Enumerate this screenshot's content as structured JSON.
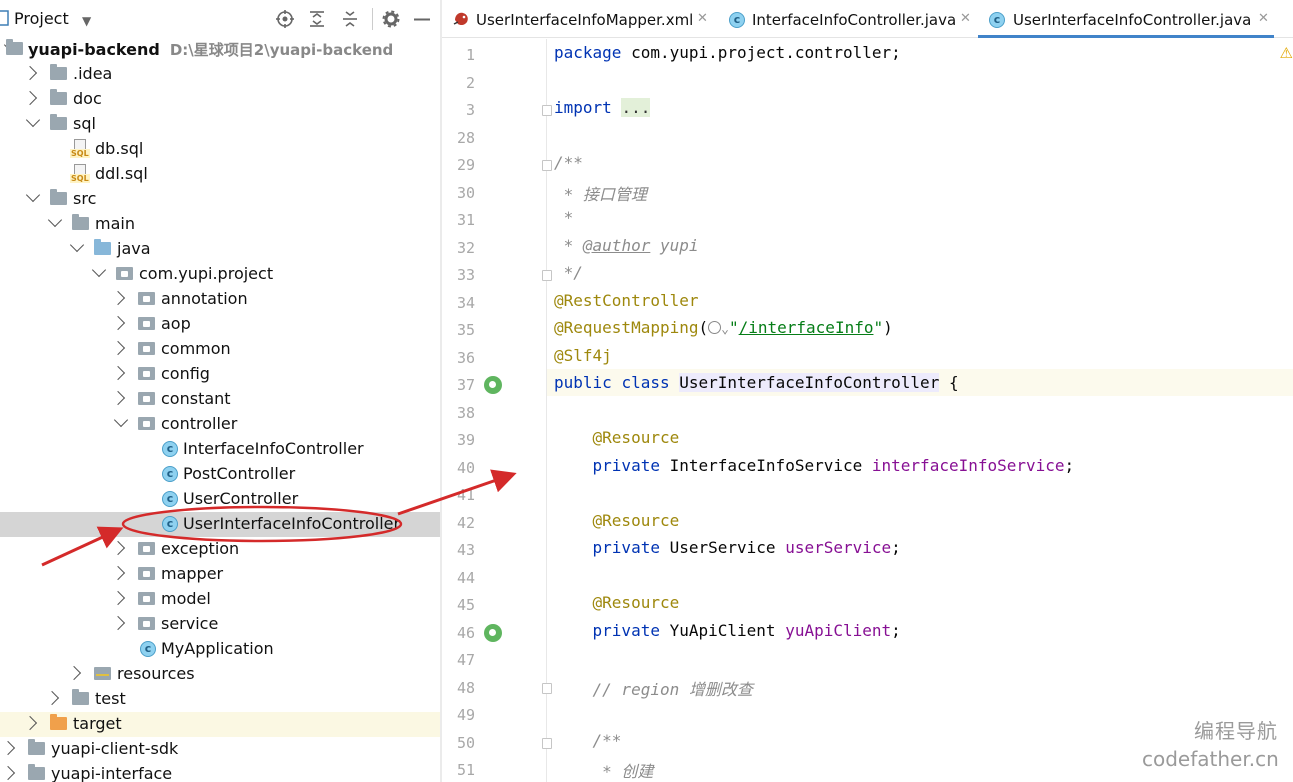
{
  "project_panel": {
    "title": "Project",
    "icons": [
      "locate-icon",
      "expand-all-icon",
      "collapse-all-icon",
      "gear-icon",
      "hide-icon"
    ],
    "tree": [
      {
        "label": "yuapi-backend",
        "path": "D:\\星球项目2\\yuapi-backend",
        "icon": "module-folder",
        "arrow": "expanded",
        "depth": 0
      },
      {
        "label": ".idea",
        "icon": "folder",
        "arrow": "collapsed",
        "depth": 1
      },
      {
        "label": "doc",
        "icon": "folder",
        "arrow": "collapsed",
        "depth": 1
      },
      {
        "label": "sql",
        "icon": "folder",
        "arrow": "expanded",
        "depth": 1
      },
      {
        "label": "db.sql",
        "icon": "sql-file",
        "arrow": "none",
        "depth": 2
      },
      {
        "label": "ddl.sql",
        "icon": "sql-file",
        "arrow": "none",
        "depth": 2
      },
      {
        "label": "src",
        "icon": "folder",
        "arrow": "expanded",
        "depth": 1
      },
      {
        "label": "main",
        "icon": "folder",
        "arrow": "expanded",
        "depth": 2
      },
      {
        "label": "java",
        "icon": "folder-blue",
        "arrow": "expanded",
        "depth": 3
      },
      {
        "label": "com.yupi.project",
        "icon": "package",
        "arrow": "expanded",
        "depth": 4
      },
      {
        "label": "annotation",
        "icon": "package",
        "arrow": "collapsed",
        "depth": 5
      },
      {
        "label": "aop",
        "icon": "package",
        "arrow": "collapsed",
        "depth": 5
      },
      {
        "label": "common",
        "icon": "package",
        "arrow": "collapsed",
        "depth": 5
      },
      {
        "label": "config",
        "icon": "package",
        "arrow": "collapsed",
        "depth": 5
      },
      {
        "label": "constant",
        "icon": "package",
        "arrow": "collapsed",
        "depth": 5
      },
      {
        "label": "controller",
        "icon": "package",
        "arrow": "expanded",
        "depth": 5
      },
      {
        "label": "InterfaceInfoController",
        "icon": "class",
        "arrow": "none",
        "depth": 6
      },
      {
        "label": "PostController",
        "icon": "class",
        "arrow": "none",
        "depth": 6
      },
      {
        "label": "UserController",
        "icon": "class",
        "arrow": "none",
        "depth": 6
      },
      {
        "label": "UserInterfaceInfoController",
        "icon": "class",
        "arrow": "none",
        "depth": 6,
        "selected": true
      },
      {
        "label": "exception",
        "icon": "package",
        "arrow": "collapsed",
        "depth": 5
      },
      {
        "label": "mapper",
        "icon": "package",
        "arrow": "collapsed",
        "depth": 5
      },
      {
        "label": "model",
        "icon": "package",
        "arrow": "collapsed",
        "depth": 5
      },
      {
        "label": "service",
        "icon": "package",
        "arrow": "collapsed",
        "depth": 5
      },
      {
        "label": "MyApplication",
        "icon": "class",
        "arrow": "none",
        "depth": 5
      },
      {
        "label": "resources",
        "icon": "resources",
        "arrow": "collapsed",
        "depth": 3
      },
      {
        "label": "test",
        "icon": "folder",
        "arrow": "collapsed",
        "depth": 2
      },
      {
        "label": "target",
        "icon": "folder-orange",
        "arrow": "collapsed",
        "depth": 1,
        "ignored": true
      },
      {
        "label": "yuapi-client-sdk",
        "icon": "folder",
        "arrow": "collapsed",
        "depth": 0
      },
      {
        "label": "yuapi-interface",
        "icon": "folder",
        "arrow": "collapsed",
        "depth": 0
      }
    ]
  },
  "editor": {
    "tabs": [
      {
        "label": "UserInterfaceInfoMapper.xml",
        "icon": "xml-mapper-icon",
        "active": false
      },
      {
        "label": "InterfaceInfoController.java",
        "icon": "class-icon",
        "active": false
      },
      {
        "label": "UserInterfaceInfoController.java",
        "icon": "class-icon",
        "active": true
      }
    ],
    "close_glyph": "✕",
    "class_glyph": "c",
    "lines": [
      {
        "n": "1",
        "tokens": [
          {
            "t": "package ",
            "c": "kw"
          },
          {
            "t": "com.yupi.project.controller;",
            "c": ""
          }
        ]
      },
      {
        "n": "2",
        "tokens": []
      },
      {
        "n": "3",
        "tokens": [
          {
            "t": "import ",
            "c": "kw"
          },
          {
            "t": "...",
            "c": "ellipsis"
          }
        ],
        "fold": true
      },
      {
        "n": "28",
        "tokens": []
      },
      {
        "n": "29",
        "tokens": [
          {
            "t": "/**",
            "c": "cmt"
          }
        ],
        "fold": true
      },
      {
        "n": "30",
        "tokens": [
          {
            "t": " * 接口管理",
            "c": "cmt"
          }
        ]
      },
      {
        "n": "31",
        "tokens": [
          {
            "t": " *",
            "c": "cmt"
          }
        ]
      },
      {
        "n": "32",
        "tokens": [
          {
            "t": " * ",
            "c": "cmt"
          },
          {
            "t": "@author",
            "c": "cmt link"
          },
          {
            "t": " yupi",
            "c": "cmt"
          }
        ]
      },
      {
        "n": "33",
        "tokens": [
          {
            "t": " */",
            "c": "cmt"
          }
        ],
        "fold": true
      },
      {
        "n": "34",
        "tokens": [
          {
            "t": "@RestController",
            "c": "ann"
          }
        ]
      },
      {
        "n": "35",
        "tokens": [
          {
            "t": "@RequestMapping",
            "c": "ann"
          },
          {
            "t": "(",
            "c": ""
          },
          {
            "t": "GLOBE",
            "c": "globe"
          },
          {
            "t": "\"",
            "c": "str"
          },
          {
            "t": "/interfaceInfo",
            "c": "str link"
          },
          {
            "t": "\"",
            "c": "str"
          },
          {
            "t": ")",
            "c": ""
          }
        ]
      },
      {
        "n": "36",
        "tokens": [
          {
            "t": "@Slf4j",
            "c": "ann"
          }
        ]
      },
      {
        "n": "37",
        "tokens": [
          {
            "t": "public ",
            "c": "kw"
          },
          {
            "t": "class ",
            "c": "kw"
          },
          {
            "t": "UserInterfaceInfoController",
            "c": "cls-hl"
          },
          {
            "t": " {",
            "c": ""
          }
        ],
        "gicon": true
      },
      {
        "n": "38",
        "tokens": []
      },
      {
        "n": "39",
        "tokens": [
          {
            "t": "    ",
            "c": ""
          },
          {
            "t": "@Resource",
            "c": "ann"
          }
        ]
      },
      {
        "n": "40",
        "tokens": [
          {
            "t": "    ",
            "c": ""
          },
          {
            "t": "private ",
            "c": "kw"
          },
          {
            "t": "InterfaceInfoService ",
            "c": ""
          },
          {
            "t": "interfaceInfoService",
            "c": "field"
          },
          {
            "t": ";",
            "c": ""
          }
        ]
      },
      {
        "n": "41",
        "tokens": []
      },
      {
        "n": "42",
        "tokens": [
          {
            "t": "    ",
            "c": ""
          },
          {
            "t": "@Resource",
            "c": "ann"
          }
        ]
      },
      {
        "n": "43",
        "tokens": [
          {
            "t": "    ",
            "c": ""
          },
          {
            "t": "private ",
            "c": "kw"
          },
          {
            "t": "UserService ",
            "c": ""
          },
          {
            "t": "userService",
            "c": "field"
          },
          {
            "t": ";",
            "c": ""
          }
        ]
      },
      {
        "n": "44",
        "tokens": []
      },
      {
        "n": "45",
        "tokens": [
          {
            "t": "    ",
            "c": ""
          },
          {
            "t": "@Resource",
            "c": "ann"
          }
        ]
      },
      {
        "n": "46",
        "tokens": [
          {
            "t": "    ",
            "c": ""
          },
          {
            "t": "private ",
            "c": "kw"
          },
          {
            "t": "YuApiClient ",
            "c": ""
          },
          {
            "t": "yuApiClient",
            "c": "field"
          },
          {
            "t": ";",
            "c": ""
          }
        ],
        "gicon": true
      },
      {
        "n": "47",
        "tokens": []
      },
      {
        "n": "48",
        "tokens": [
          {
            "t": "    ",
            "c": ""
          },
          {
            "t": "// region 增删改查",
            "c": "cmt"
          }
        ],
        "fold": true
      },
      {
        "n": "49",
        "tokens": []
      },
      {
        "n": "50",
        "tokens": [
          {
            "t": "    ",
            "c": ""
          },
          {
            "t": "/**",
            "c": "cmt"
          }
        ],
        "fold": true
      },
      {
        "n": "51",
        "tokens": [
          {
            "t": "     * 创建",
            "c": "cmt"
          }
        ]
      }
    ],
    "warning_glyph": "⚠"
  },
  "watermark": {
    "line1": "编程导航",
    "line2": "codefather.cn"
  },
  "colors": {
    "keyword": "#0033b3",
    "annotation": "#9e880d",
    "comment": "#8c8c8c",
    "field": "#871094",
    "string": "#067d17",
    "highlight_red": "#d42a2a",
    "tab_underline": "#4083c9"
  }
}
